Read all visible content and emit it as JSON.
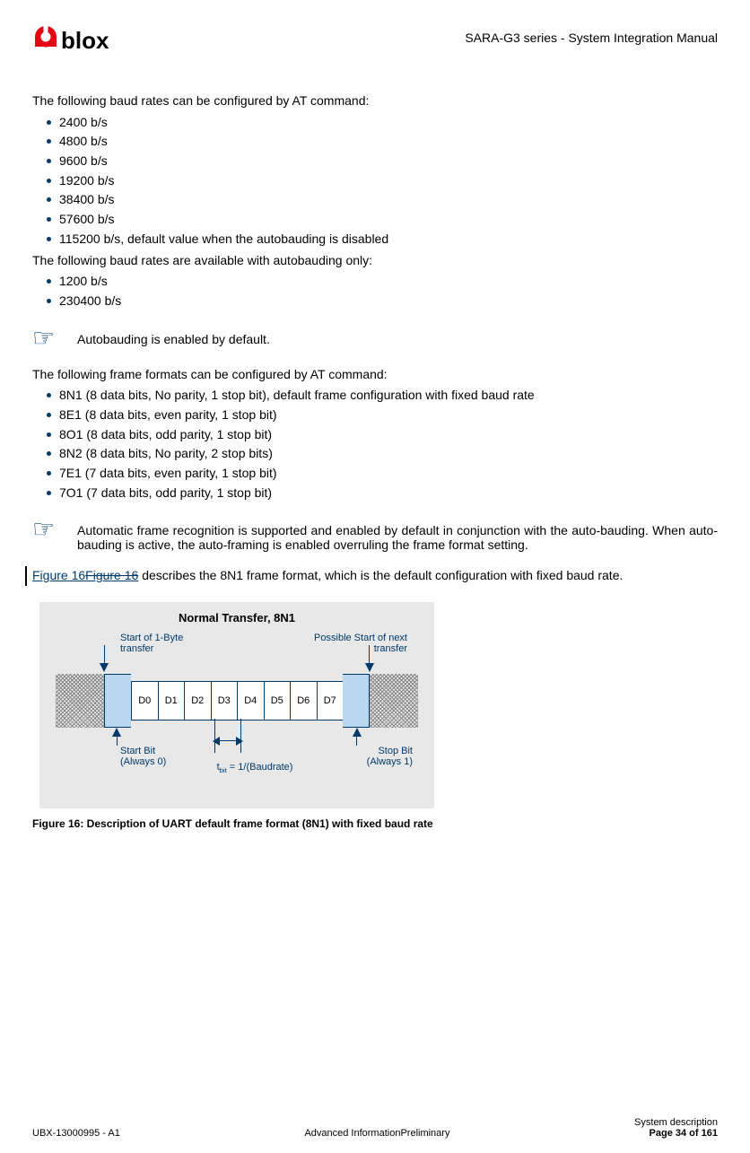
{
  "header": {
    "logo_text": "blox",
    "doc_title": "SARA-G3 series - System Integration Manual"
  },
  "intro1": "The following baud rates can be configured by AT command:",
  "baud_list1": [
    "2400 b/s",
    "4800 b/s",
    "9600 b/s",
    "19200 b/s",
    "38400 b/s",
    "57600 b/s",
    "115200 b/s, default value when the autobauding is disabled"
  ],
  "intro2": "The following baud rates are available with autobauding only:",
  "baud_list2": [
    "1200 b/s",
    "230400 b/s"
  ],
  "note1": "Autobauding is enabled by default.",
  "intro3": "The following frame formats can be configured by AT command:",
  "frame_list": [
    "8N1 (8 data bits, No parity, 1 stop bit), default frame configuration with fixed baud rate",
    "8E1 (8 data bits, even parity, 1 stop bit)",
    "8O1 (8 data bits, odd parity, 1 stop bit)",
    "8N2 (8 data bits, No parity, 2 stop bits)",
    "7E1 (7 data bits, even parity, 1 stop bit)",
    "7O1 (7 data bits, odd parity, 1 stop bit)"
  ],
  "note2": "Automatic frame recognition is supported and enabled by default in conjunction with the auto-bauding. When auto-bauding is active, the auto-framing is enabled overruling the frame format setting.",
  "fig_ref": {
    "new": "Figure 16",
    "old": "Figure 16",
    "rest": " describes the 8N1 frame format, which is the default configuration with fixed baud rate."
  },
  "diagram": {
    "title": "Normal Transfer, 8N1",
    "start_label": "Start of 1-Byte transfer",
    "next_label": "Possible Start of next transfer",
    "bits": [
      "D0",
      "D1",
      "D2",
      "D3",
      "D4",
      "D5",
      "D6",
      "D7"
    ],
    "start_bit_label1": "Start Bit",
    "start_bit_label2": "(Always 0)",
    "stop_bit_label1": "Stop Bit",
    "stop_bit_label2": "(Always 1)",
    "tbit": "t",
    "tbit_sub": "bit",
    "tbit_rest": " = 1/(Baudrate)"
  },
  "figure_caption": "Figure 16: Description of UART default frame format (8N1) with fixed baud rate",
  "footer": {
    "left": "UBX-13000995 - A1",
    "center": "Advanced InformationPreliminary",
    "right_top": "System description",
    "right_bottom": "Page 34 of 161"
  }
}
